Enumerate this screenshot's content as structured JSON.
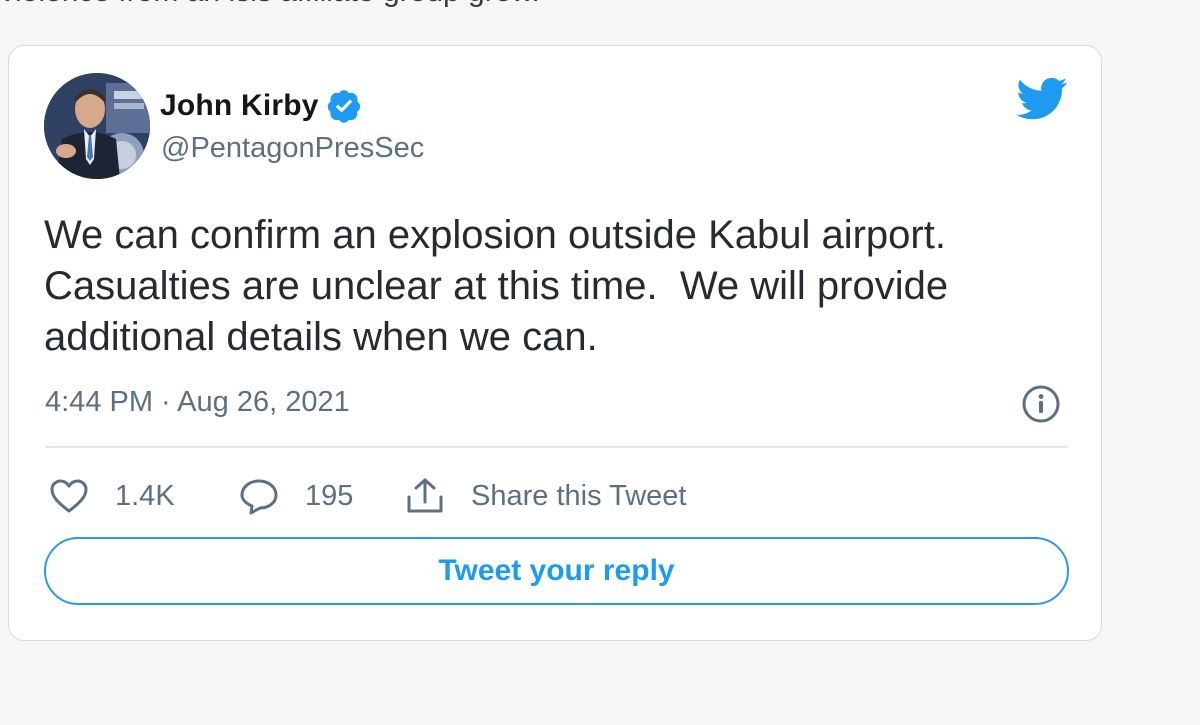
{
  "article": {
    "cut_text": "violence from an isis affiliate group grew."
  },
  "tweet": {
    "author_name": "John Kirby",
    "handle": "@PentagonPresSec",
    "verified": true,
    "text_lines": [
      "We can confirm an explosion outside Kabul airport.",
      "Casualties are unclear at this time.  We will provide",
      "additional details when we can."
    ],
    "timestamp": "4:44 PM · Aug 26, 2021",
    "likes": "1.4K",
    "replies": "195",
    "share_label": "Share this Tweet",
    "reply_button_label": "Tweet your reply"
  },
  "icons": {
    "brand": "twitter-bird-icon",
    "verified": "verified-badge-icon",
    "info": "info-icon",
    "like": "heart-icon",
    "reply": "comment-icon",
    "share": "share-icon"
  },
  "colors": {
    "accent": "#1d9bf0",
    "text_primary": "#14171a",
    "text_secondary": "#5b7083",
    "border": "#d4dbe0"
  }
}
